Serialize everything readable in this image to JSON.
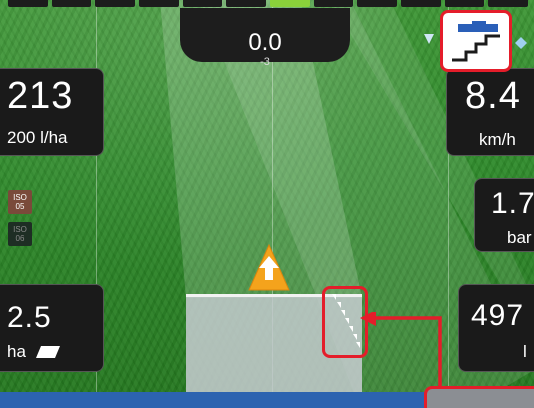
{
  "heading": {
    "value": "0.0",
    "sub": "-3"
  },
  "widgets": {
    "rate": {
      "value": "213",
      "unit": "200 l/ha"
    },
    "area": {
      "value": "2.5",
      "unit": "ha"
    },
    "speed": {
      "value": "8.4",
      "unit": "km/h"
    },
    "pressure": {
      "value": "1.7",
      "unit": "bar"
    },
    "volume": {
      "value": "497",
      "unit": "l"
    }
  },
  "iso_badges": [
    {
      "label_top": "ISO",
      "label_bottom": "05"
    },
    {
      "label_top": "ISO",
      "label_bottom": "06"
    }
  ],
  "icons": {
    "tractor_marker": "up-arrow-triangle-icon",
    "mode": "section-control-mode-icon",
    "sections": "boom-sections-stairs-icon",
    "area_shape": "parallelogram-area-icon"
  },
  "colors": {
    "accent_green": "#8ad13a",
    "annotation_red": "#e41d2a",
    "marker_orange": "#f4a31c",
    "bottom_bar": "#2c63b0"
  }
}
